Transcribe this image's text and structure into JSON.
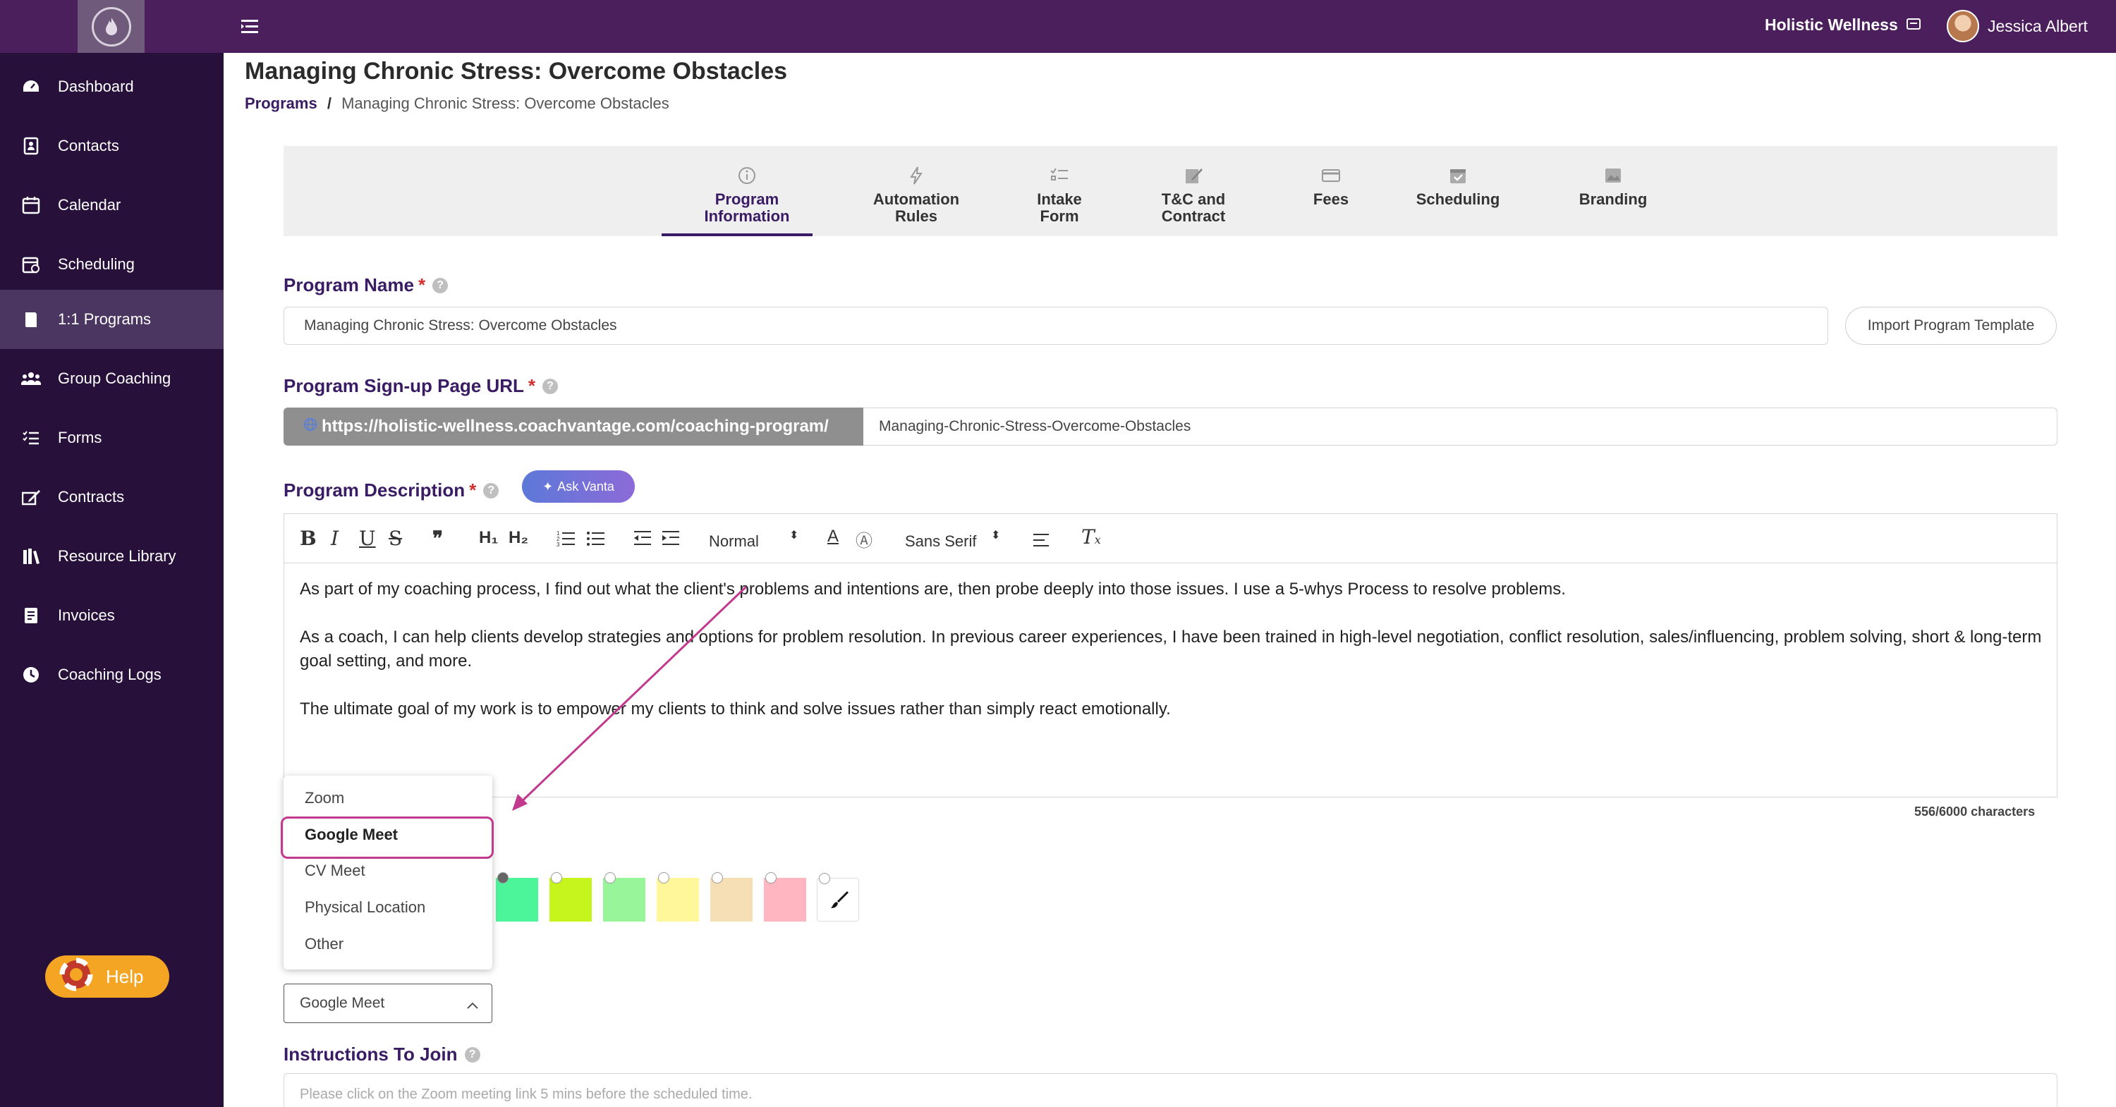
{
  "header": {
    "org_name": "Holistic Wellness",
    "user_name": "Jessica Albert"
  },
  "sidebar": {
    "items": [
      {
        "label": "Dashboard",
        "icon": "dashboard-icon"
      },
      {
        "label": "Contacts",
        "icon": "contacts-icon"
      },
      {
        "label": "Calendar",
        "icon": "calendar-icon"
      },
      {
        "label": "Scheduling",
        "icon": "scheduling-icon"
      },
      {
        "label": "1:1 Programs",
        "icon": "book-icon",
        "active": true
      },
      {
        "label": "Group Coaching",
        "icon": "group-icon"
      },
      {
        "label": "Forms",
        "icon": "list-icon"
      },
      {
        "label": "Contracts",
        "icon": "signature-icon"
      },
      {
        "label": "Resource Library",
        "icon": "library-icon"
      },
      {
        "label": "Invoices",
        "icon": "invoice-icon"
      },
      {
        "label": "Coaching Logs",
        "icon": "clock-icon"
      }
    ],
    "help_label": "Help"
  },
  "page": {
    "title": "Managing Chronic Stress: Overcome Obstacles",
    "breadcrumb_root": "Programs",
    "breadcrumb_sep": "/",
    "breadcrumb_current": "Managing Chronic Stress: Overcome Obstacles"
  },
  "tabs": [
    {
      "line1": "Program",
      "line2": "Information",
      "icon": "info-icon",
      "active": true
    },
    {
      "line1": "Automation",
      "line2": "Rules",
      "icon": "lightning-icon"
    },
    {
      "line1": "Intake",
      "line2": "Form",
      "icon": "checklist-icon"
    },
    {
      "line1": "T&C and",
      "line2": "Contract",
      "icon": "contract-icon"
    },
    {
      "line1": "Fees",
      "line2": "",
      "icon": "card-icon"
    },
    {
      "line1": "Scheduling",
      "line2": "",
      "icon": "calendar-check-icon"
    },
    {
      "line1": "Branding",
      "line2": "",
      "icon": "image-icon"
    }
  ],
  "form": {
    "program_name_label": "Program Name",
    "required_mark": "*",
    "program_name_value": "Managing Chronic Stress: Overcome Obstacles",
    "import_template_label": "Import Program Template",
    "signup_url_label": "Program Sign-up Page URL",
    "url_prefix": "https://holistic-wellness.coachvantage.com/coaching-program/",
    "url_slug": "Managing-Chronic-Stress-Overcome-Obstacles",
    "description_label": "Program Description",
    "ask_vanta_label": "Ask Vanta",
    "toolbar": {
      "heading_select": "Normal",
      "font_select": "Sans Serif"
    },
    "description_paragraphs": [
      "As part of my coaching process, I find out what the client's problems and intentions are, then probe deeply into those issues. I use a 5-whys Process to resolve problems.",
      "As a coach, I can help clients develop strategies and options for problem resolution. In previous career experiences, I have been trained in high-level negotiation, conflict resolution, sales/influencing, problem solving, short & long-term goal setting, and more.",
      "The ultimate goal of my work is to empower my clients to think and solve issues rather than simply react emotionally."
    ],
    "char_count": "556/6000 characters",
    "color_swatches": [
      "#4cf59a",
      "#c6f51e",
      "#99f59a",
      "#fff799",
      "#f7dfb5",
      "#ffb6c1"
    ],
    "location_options": [
      "Zoom",
      "Google Meet",
      "CV Meet",
      "Physical Location",
      "Other"
    ],
    "location_selected": "Google Meet",
    "instructions_label": "Instructions To Join",
    "instructions_placeholder": "Please click on the Zoom meeting link 5 mins before the scheduled time."
  },
  "colors": {
    "topbar": "#4b1e5c",
    "sidebar": "#27103a",
    "accent": "#3a1c64",
    "annotation": "#c23a8e"
  }
}
